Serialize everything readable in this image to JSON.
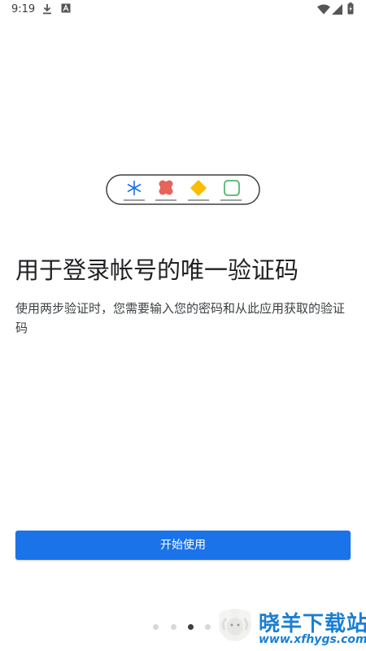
{
  "status_bar": {
    "time": "9:19",
    "left_icons": [
      "download-icon",
      "font-a-icon"
    ],
    "right_icons": [
      "wifi-icon",
      "signal-icon",
      "battery-icon"
    ]
  },
  "illustration": {
    "icons": [
      "asterisk-icon",
      "red-cloud-icon",
      "orange-diamond-icon",
      "green-square-icon"
    ],
    "colors": {
      "asterisk": "#1a73e8",
      "cloud": "#e8635a",
      "diamond": "#fbbc04",
      "square": "#34a853",
      "outline": "#3c4043"
    }
  },
  "title": "用于登录帐号的唯一验证码",
  "description": "使用两步验证时，您需要输入您的密码和从此应用获取的验证码",
  "start_button": {
    "label": "开始使用",
    "color": "#1a73e8"
  },
  "page_indicator": {
    "total": 4,
    "active_index": 2
  },
  "watermark": {
    "title": "晓羊下载站",
    "url": "www.xfhygs.com",
    "color": "#1a7fd4"
  }
}
